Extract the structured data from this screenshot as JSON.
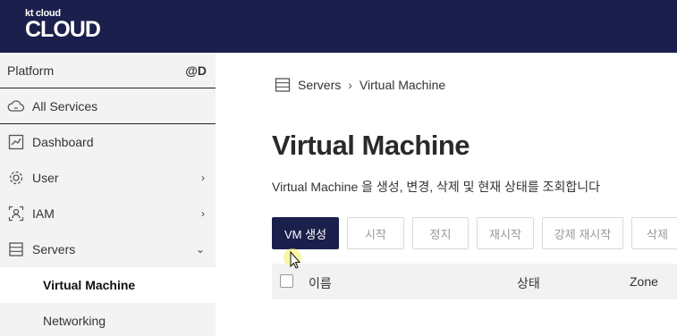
{
  "header": {
    "logo_small": "kt cloud",
    "logo_big": "CLOUD"
  },
  "sidebar": {
    "platform_label": "Platform",
    "platform_user": "@D",
    "items": [
      {
        "label": "All Services",
        "icon": "cloud-icon"
      },
      {
        "label": "Dashboard",
        "icon": "dashboard-icon"
      },
      {
        "label": "User",
        "icon": "gear-icon",
        "chevron": "›"
      },
      {
        "label": "IAM",
        "icon": "iam-icon",
        "chevron": "›"
      },
      {
        "label": "Servers",
        "icon": "server-icon",
        "chevron": "⌄"
      }
    ],
    "sub_items": [
      {
        "label": "Virtual Machine",
        "active": true
      },
      {
        "label": "Networking",
        "active": false
      }
    ]
  },
  "breadcrumb": {
    "parent": "Servers",
    "separator": "›",
    "current": "Virtual Machine"
  },
  "page": {
    "title": "Virtual Machine",
    "description": "Virtual Machine 을 생성, 변경, 삭제 및 현재 상태를 조회합니다"
  },
  "toolbar": {
    "buttons": [
      {
        "label": "VM 생성",
        "primary": true
      },
      {
        "label": "시작"
      },
      {
        "label": "정지"
      },
      {
        "label": "재시작"
      },
      {
        "label": "강제 재시작"
      },
      {
        "label": "삭제"
      }
    ]
  },
  "table": {
    "columns": [
      "이름",
      "상태",
      "Zone"
    ]
  },
  "colors": {
    "navy": "#1b1f4b",
    "sidebar_bg": "#f3f3f3",
    "table_head_bg": "#f2f2f2"
  }
}
